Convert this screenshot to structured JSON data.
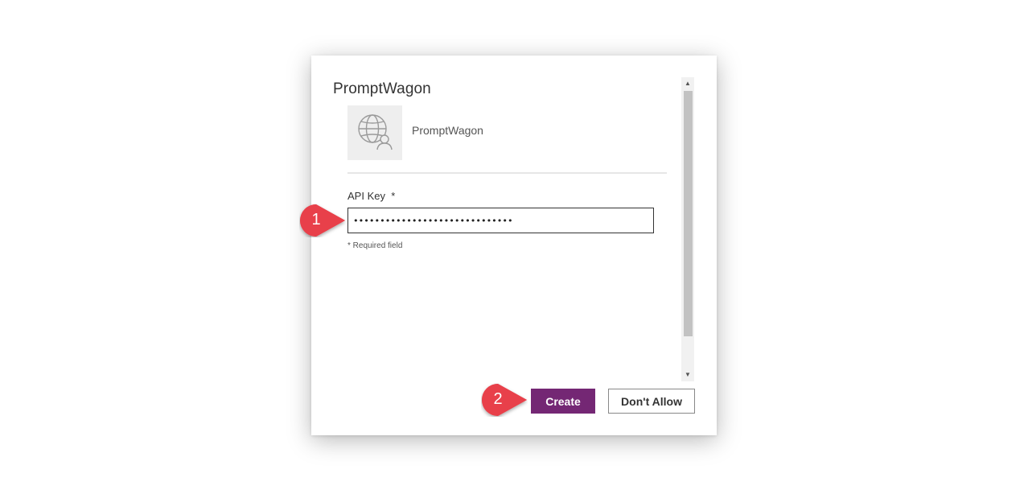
{
  "dialog": {
    "title": "PromptWagon",
    "connector_name": "PromptWagon",
    "connector_icon": "globe-user-icon"
  },
  "form": {
    "api_key_label": "API Key  *",
    "api_key_value": "••••••••••••••••••••••••••••••",
    "required_note": "* Required field"
  },
  "buttons": {
    "create_label": "Create",
    "dont_allow_label": "Don't Allow"
  },
  "callouts": {
    "step1": "1",
    "step2": "2"
  },
  "colors": {
    "accent": "#742774",
    "callout": "#e8404a"
  },
  "scrollbar": {
    "up_icon": "scroll-up-arrow-icon",
    "down_icon": "scroll-down-arrow-icon"
  }
}
